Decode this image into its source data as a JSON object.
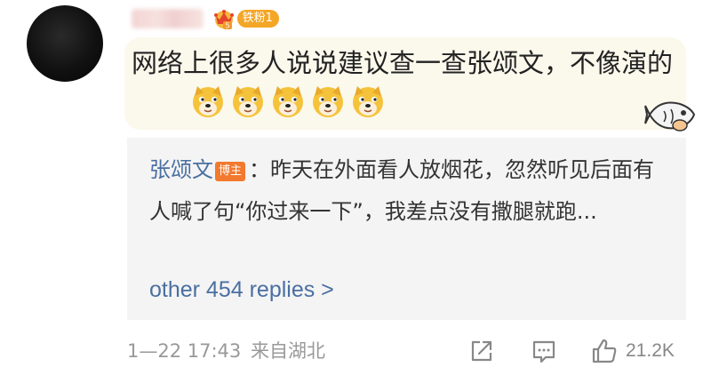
{
  "comment": {
    "username": "••••••",
    "fan_badge": "铁粉1",
    "crown_level": "5",
    "text": "网络上很多人说说建议查一查张颂文，不像演的",
    "emojis": [
      "doge-icon",
      "doge-icon",
      "doge-icon",
      "doge-icon",
      "doge-icon"
    ]
  },
  "reply": {
    "author": "张颂文",
    "badge": "博主",
    "separator": "：",
    "text": "昨天在外面看人放烟花，忽然听见后面有人喊了句“你过来一下”，我差点没有撒腿就跑...",
    "more_replies": "other 454 replies >"
  },
  "footer": {
    "timestamp": "1—22 17:43",
    "location": "来自湖北",
    "like_count": "21.2K"
  },
  "colors": {
    "link_blue": "#4a6fa1",
    "fan_badge": "#f4a626",
    "blogger_badge": "#f2792e",
    "bubble": "#fbf8ec",
    "reply_bg": "#f4f4f4"
  }
}
